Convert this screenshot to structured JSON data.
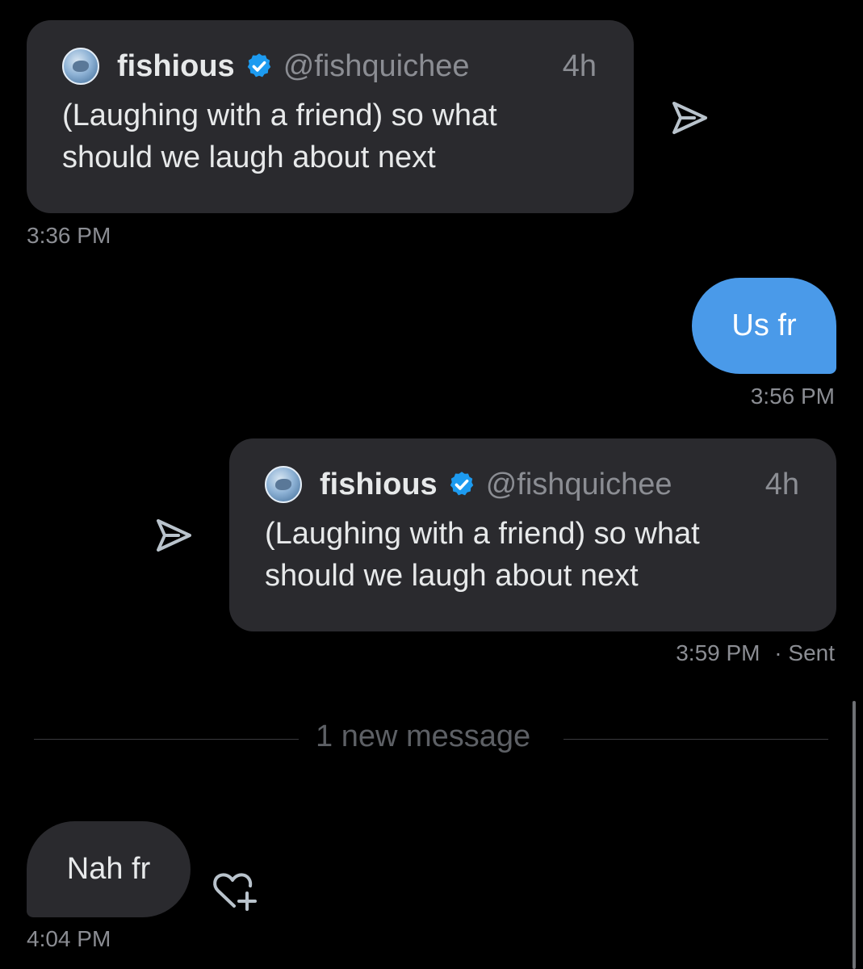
{
  "messages": [
    {
      "type": "shared_tweet",
      "direction": "received",
      "tweet": {
        "display_name": "fishious",
        "handle": "@fishquichee",
        "age": "4h",
        "text_line1": "(Laughing with a friend) so what",
        "text_line2": "should we laugh about next",
        "verified": true
      },
      "timestamp": "3:36 PM"
    },
    {
      "type": "text",
      "direction": "sent",
      "text": "Us fr",
      "timestamp": "3:56 PM"
    },
    {
      "type": "shared_tweet",
      "direction": "sent",
      "tweet": {
        "display_name": "fishious",
        "handle": "@fishquichee",
        "age": "4h",
        "text_line1": "(Laughing with a friend) so what",
        "text_line2": "should we laugh about next",
        "verified": true
      },
      "timestamp": "3:59 PM",
      "status": "· Sent"
    },
    {
      "type": "divider",
      "label": "1 new message"
    },
    {
      "type": "text",
      "direction": "received",
      "text": "Nah fr",
      "timestamp": "4:04 PM"
    }
  ],
  "icons": {
    "share": "paper-plane-icon",
    "verified": "verified-badge-icon",
    "react": "heart-plus-icon"
  },
  "colors": {
    "background": "#000000",
    "bubble_received": "#2a2a2e",
    "bubble_sent": "#4a9ae9",
    "verified_blue": "#1d9bf0",
    "muted_text": "#8b8d93"
  }
}
